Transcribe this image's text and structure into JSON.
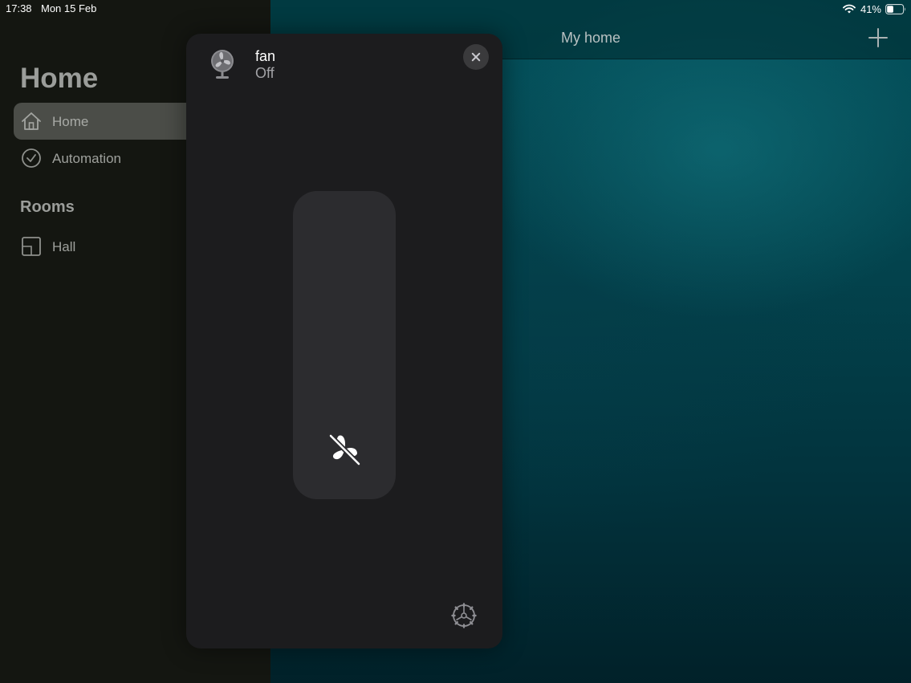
{
  "status_bar": {
    "time": "17:38",
    "date": "Mon 15 Feb",
    "battery": "41%",
    "battery_level": 0.41,
    "wifi_icon": "wifi-icon",
    "battery_icon": "battery-icon"
  },
  "sidebar": {
    "title": "Home",
    "items": [
      {
        "label": "Home",
        "icon": "house-icon",
        "selected": true
      },
      {
        "label": "Automation",
        "icon": "clock-icon",
        "selected": false
      }
    ],
    "rooms_header": "Rooms",
    "rooms": [
      {
        "label": "Hall",
        "icon": "room-icon"
      }
    ]
  },
  "main": {
    "title": "My home",
    "add_icon": "plus-icon"
  },
  "fan_card": {
    "name": "fan",
    "state": "Off",
    "speed_level": 0,
    "icons": {
      "accessory": "fan-icon",
      "close": "close-icon",
      "slider_state": "fan-off-icon",
      "settings": "gear-icon"
    }
  },
  "colors": {
    "card_background": "#1c1c1e",
    "slider_track": "#2c2c2f",
    "sidebar_background": "#141611",
    "accent_teal": "#04515c"
  }
}
